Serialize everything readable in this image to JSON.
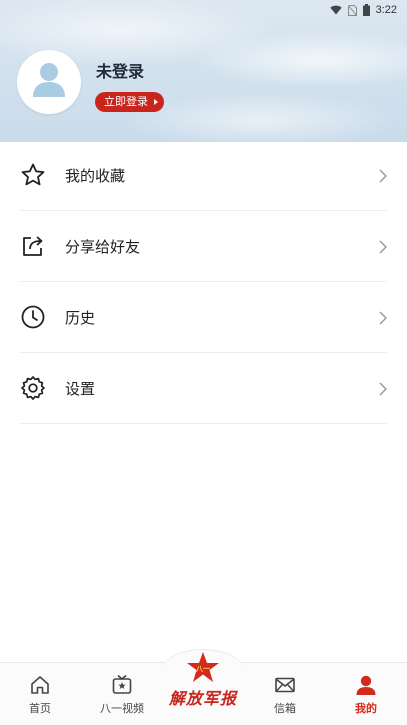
{
  "status_bar": {
    "time": "3:22",
    "icons": [
      "wifi-icon",
      "no-sim-icon",
      "battery-icon"
    ]
  },
  "profile": {
    "avatar_icon": "user-avatar-icon",
    "name": "未登录",
    "login_button": "立即登录"
  },
  "menu": {
    "items": [
      {
        "label": "我的收藏",
        "icon": "star-icon"
      },
      {
        "label": "分享给好友",
        "icon": "share-icon"
      },
      {
        "label": "历史",
        "icon": "clock-icon"
      },
      {
        "label": "设置",
        "icon": "gear-icon"
      }
    ]
  },
  "bottom_nav": {
    "items": [
      {
        "label": "首页",
        "icon": "home-icon"
      },
      {
        "label": "八一视频",
        "icon": "tv-icon"
      },
      {
        "label": "信箱",
        "icon": "mail-icon"
      },
      {
        "label": "我的",
        "icon": "user-icon",
        "active": true
      }
    ],
    "center_logo_text": "解放军报",
    "center_logo_icon": "red-star-emblem-icon"
  },
  "colors": {
    "accent": "#c8261c",
    "active_tab": "#d42a1e",
    "header_sky": "#d2e1ee",
    "avatar_fill": "#a9cce3"
  }
}
